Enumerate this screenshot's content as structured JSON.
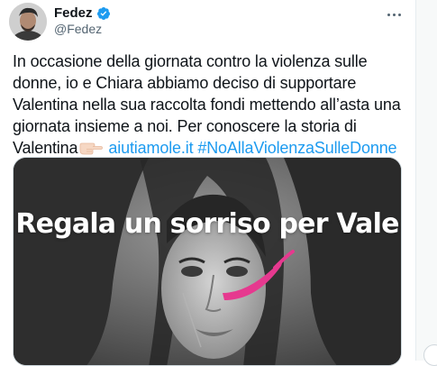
{
  "tweet": {
    "author_name": "Fedez",
    "author_handle": "@Fedez",
    "text_lines": [
      "In occasione della giornata contro la violenza sulle",
      "donne, io e Chiara abbiamo deciso di supportare",
      "Valentina nella sua raccolta fondi mettendo all’asta una",
      "giornata insieme a noi. Per conoscere la storia di"
    ],
    "last_line_prefix": "Valentina",
    "link_url": "aiutiamole.it",
    "hashtag": "#NoAllaViolenzaSulleDonne",
    "media_headline": "Regala un sorriso per Vale"
  },
  "colors": {
    "link": "#1d9bf0",
    "verified": "#1d9bf0",
    "accent_pink": "#e6398f"
  },
  "icons": {
    "verified": "verified-badge-icon",
    "more": "more-options-icon",
    "emoji": "pointing-right-hand-emoji"
  }
}
